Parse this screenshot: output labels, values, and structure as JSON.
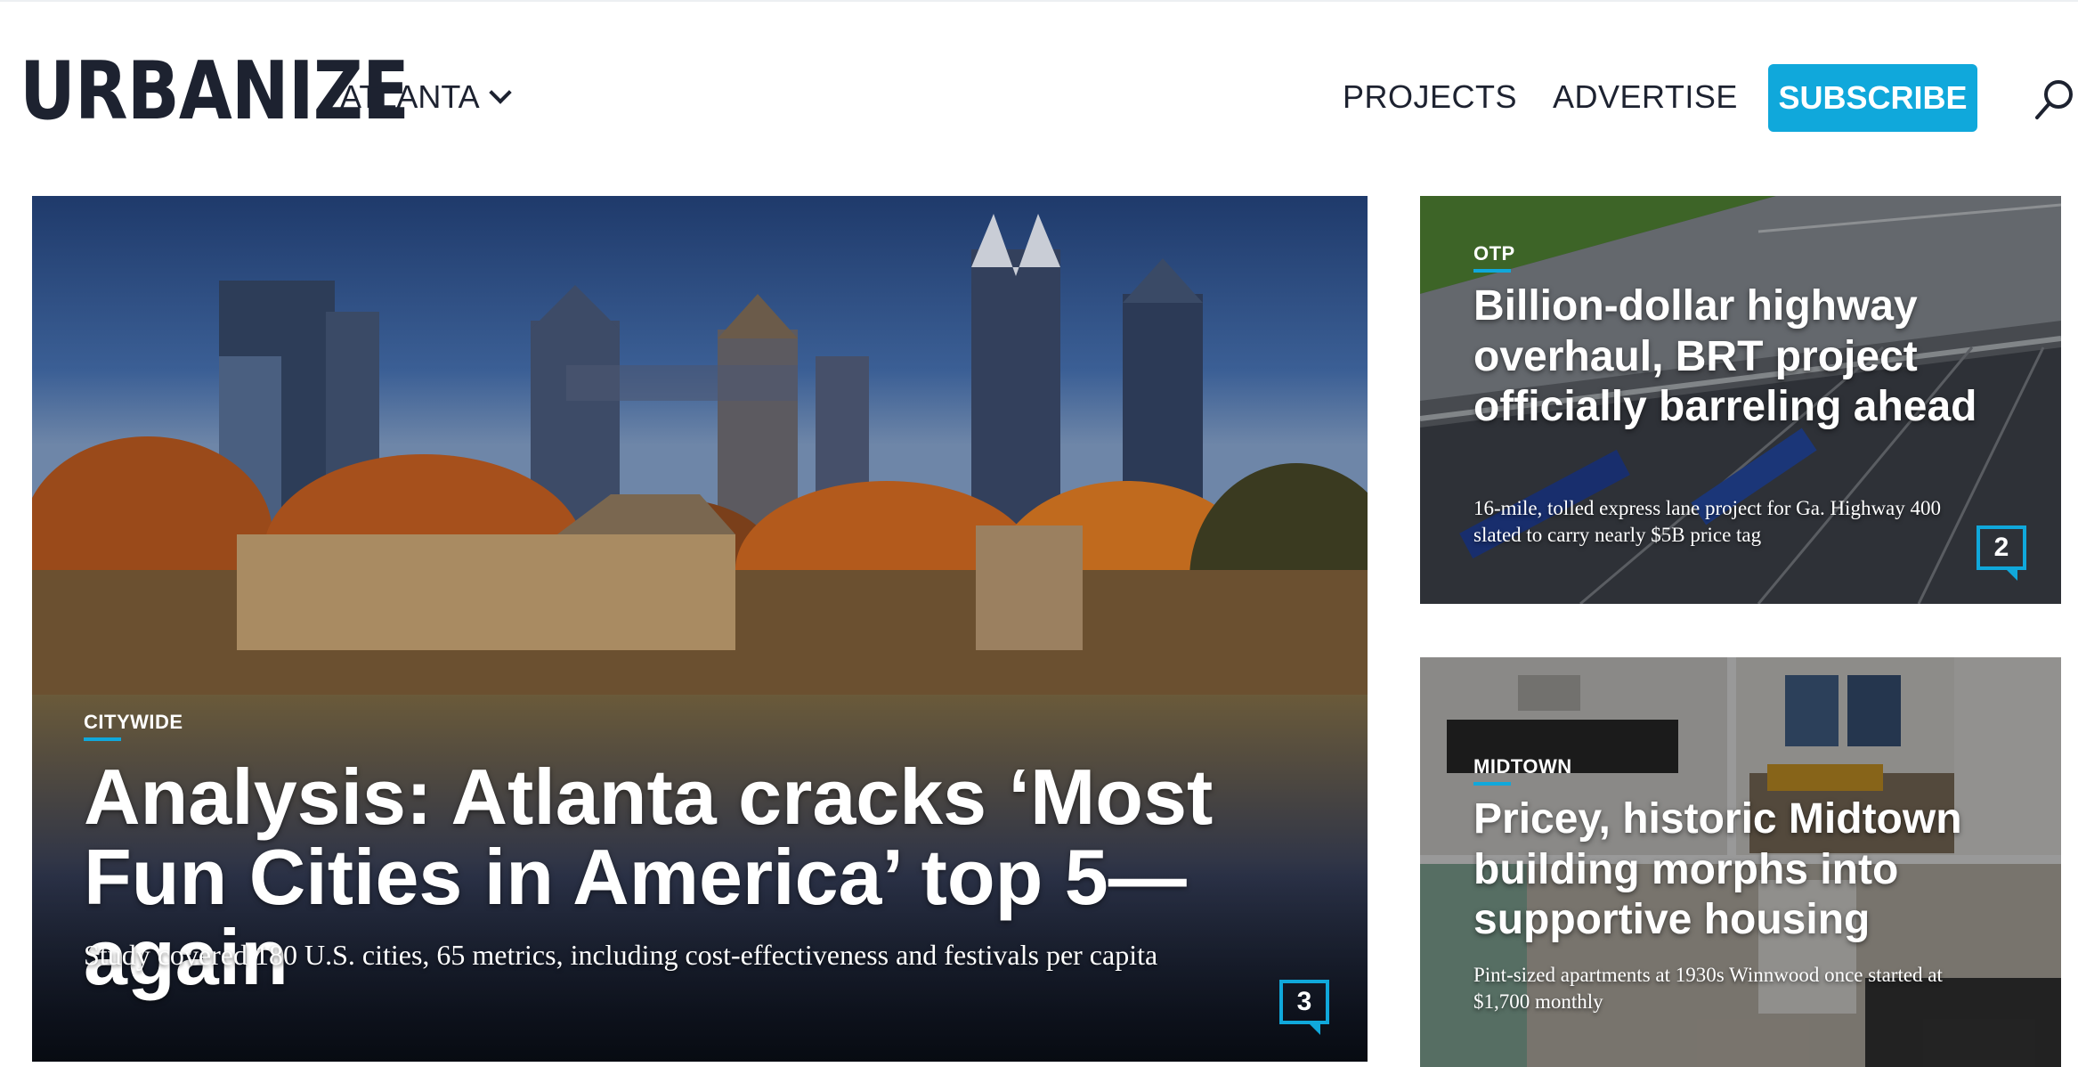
{
  "header": {
    "logo": "URBANIZE",
    "city": "ATLANTA",
    "nav": {
      "projects": "PROJECTS",
      "advertise": "ADVERTISE"
    },
    "subscribe": "SUBSCRIBE"
  },
  "stories": {
    "main": {
      "category": "CITYWIDE",
      "title": "Analysis: Atlanta cracks ‘Most Fun Cities in America’ top 5—again",
      "deck": "Study covered 180 U.S. cities, 65 metrics, including cost-effectiveness and festivals per capita",
      "comments": "3"
    },
    "top": {
      "category": "OTP",
      "title": "Billion-dollar highway overhaul, BRT project officially barreling ahead",
      "deck": "16-mile, tolled express lane project for Ga. Highway 400 slated to carry nearly $5B price tag",
      "comments": "2"
    },
    "bottom": {
      "category": "MIDTOWN",
      "title": "Pricey, historic Midtown building morphs into supportive housing",
      "deck": "Pint-sized apartments at 1930s Winnwood once started at $1,700 monthly"
    }
  },
  "colors": {
    "accent": "#10a8db",
    "text": "#1d2230"
  },
  "icons": {
    "search": "search-icon",
    "chevron": "chevron-down-icon",
    "comments": "comment-bubble-icon"
  }
}
